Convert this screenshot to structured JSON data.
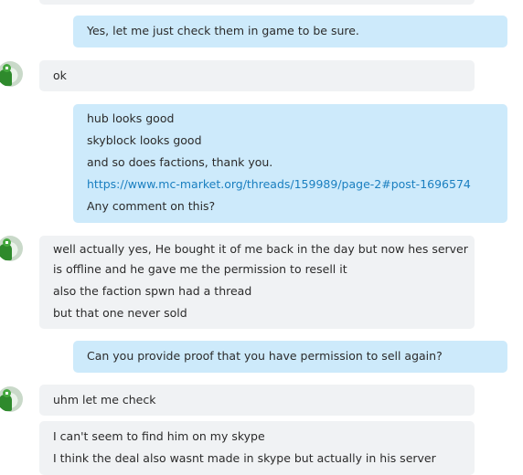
{
  "messages": [
    {
      "dir": "out",
      "lines": [
        "Yes, let me just check them in game to be sure."
      ]
    },
    {
      "dir": "in",
      "lines": [
        "ok"
      ]
    },
    {
      "dir": "out",
      "lines": [
        "hub looks good",
        "skyblock looks good",
        "and so does factions, thank you.",
        "https://www.mc-market.org/threads/159989/page-2#post-1696574",
        "Any comment on this?"
      ]
    },
    {
      "dir": "in",
      "lines": [
        "well actually yes, He bought it of me back in the day but now hes server",
        "is offline and he gave me the permission to resell it",
        "also the faction spwn had a thread",
        "but that one never sold"
      ]
    },
    {
      "dir": "out",
      "lines": [
        "Can you provide proof that you have permission to sell again?"
      ]
    },
    {
      "dir": "in",
      "lines": [
        "uhm let me check"
      ]
    },
    {
      "dir": "in",
      "lines": [
        "I can't seem to find him on my skype",
        "I think the deal also wasnt made in skype but actually in his server"
      ]
    }
  ]
}
